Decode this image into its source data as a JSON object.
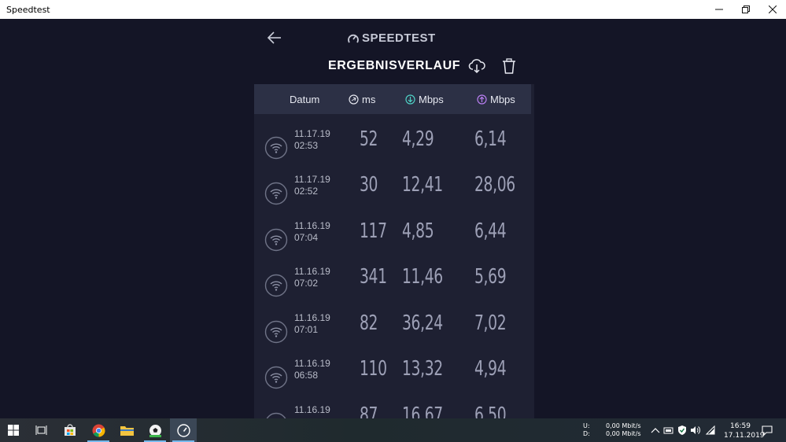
{
  "window": {
    "title": "Speedtest"
  },
  "app": {
    "logo_text": "SPEEDTEST",
    "page_title": "ERGEBNISVERLAUF"
  },
  "columns": {
    "date": "Datum",
    "ping": "ms",
    "download": "Mbps",
    "upload": "Mbps"
  },
  "results": [
    {
      "date": "11.17.19",
      "time": "02:53",
      "ping": "52",
      "download": "4,29",
      "upload": "6,14"
    },
    {
      "date": "11.17.19",
      "time": "02:52",
      "ping": "30",
      "download": "12,41",
      "upload": "28,06"
    },
    {
      "date": "11.16.19",
      "time": "07:04",
      "ping": "117",
      "download": "4,85",
      "upload": "6,44"
    },
    {
      "date": "11.16.19",
      "time": "07:02",
      "ping": "341",
      "download": "11,46",
      "upload": "5,69"
    },
    {
      "date": "11.16.19",
      "time": "07:01",
      "ping": "82",
      "download": "36,24",
      "upload": "7,02"
    },
    {
      "date": "11.16.19",
      "time": "06:58",
      "ping": "110",
      "download": "13,32",
      "upload": "4,94"
    },
    {
      "date": "11.16.19",
      "time": "",
      "ping": "87",
      "download": "16,67",
      "upload": "6,50"
    }
  ],
  "taskbar": {
    "net_up_label": "U:",
    "net_down_label": "D:",
    "net_up_value": "0,00 Mbit/s",
    "net_down_value": "0,00 Mbit/s",
    "clock_time": "16:59",
    "clock_date": "17.11.2019"
  },
  "colors": {
    "background": "#141526",
    "panel": "#1e2032",
    "header_row": "#2c3045",
    "download_accent": "#4fd1c5",
    "upload_accent": "#b97ff2"
  }
}
